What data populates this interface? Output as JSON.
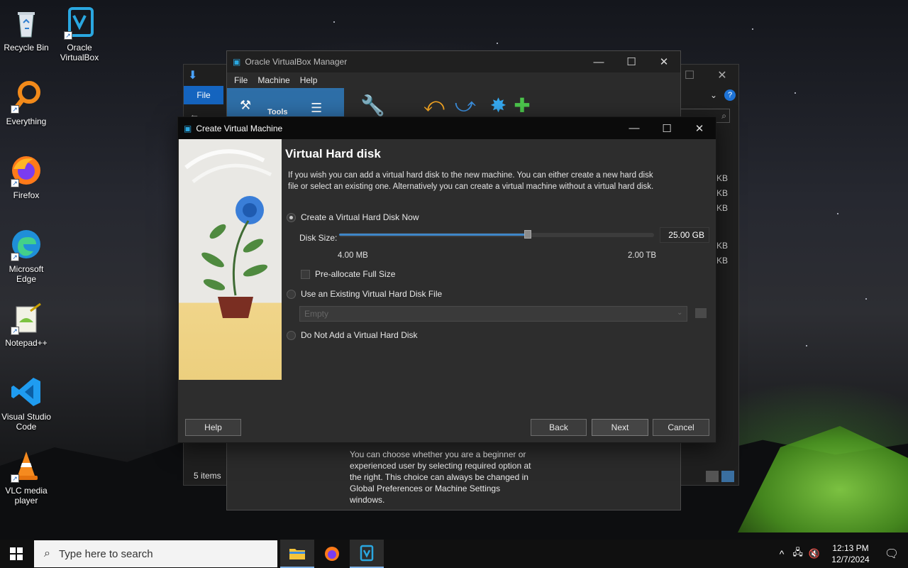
{
  "desktop": {
    "icons": [
      {
        "label": "Recycle Bin"
      },
      {
        "label": "Oracle VirtualBox"
      },
      {
        "label": "Everything"
      },
      {
        "label": "Firefox"
      },
      {
        "label": "Microsoft Edge"
      },
      {
        "label": "Notepad++"
      },
      {
        "label": "Visual Studio Code"
      },
      {
        "label": "VLC media player"
      }
    ]
  },
  "explorer": {
    "file_tab": "File",
    "status": "5 items",
    "sizes": [
      "KB",
      "KB",
      "KB",
      "KB",
      "KB"
    ]
  },
  "vbox_manager": {
    "title": "Oracle VirtualBox Manager",
    "menu": [
      "File",
      "Machine",
      "Help"
    ],
    "tools_label": "Tools",
    "info_text": "You can choose whether you are a beginner or experienced user by selecting required option at the right. This choice can always be changed in Global Preferences or Machine Settings windows."
  },
  "dialog": {
    "title": "Create Virtual Machine",
    "heading": "Virtual Hard disk",
    "description": "If you wish you can add a virtual hard disk to the new machine. You can either create a new hard disk file or select an existing one. Alternatively you can create a virtual machine without a virtual hard disk.",
    "options": {
      "create_now": "Create a Virtual Hard Disk Now",
      "use_existing": "Use an Existing Virtual Hard Disk File",
      "do_not_add": "Do Not Add a Virtual Hard Disk"
    },
    "selected_option": "create_now",
    "disk_size_label": "Disk Size:",
    "disk_size_value": "25.00 GB",
    "slider_fraction": 0.6,
    "slider_min": "4.00 MB",
    "slider_max": "2.00 TB",
    "preallocate_label": "Pre-allocate Full Size",
    "existing_placeholder": "Empty",
    "buttons": {
      "help": "Help",
      "back": "Back",
      "next": "Next",
      "cancel": "Cancel"
    }
  },
  "taskbar": {
    "search_placeholder": "Type here to search",
    "time": "12:13 PM",
    "date": "12/7/2024"
  },
  "colors": {
    "accent": "#2e6fa8",
    "dialog_bg": "#2d2d2d",
    "taskbar_bg": "#101010"
  }
}
